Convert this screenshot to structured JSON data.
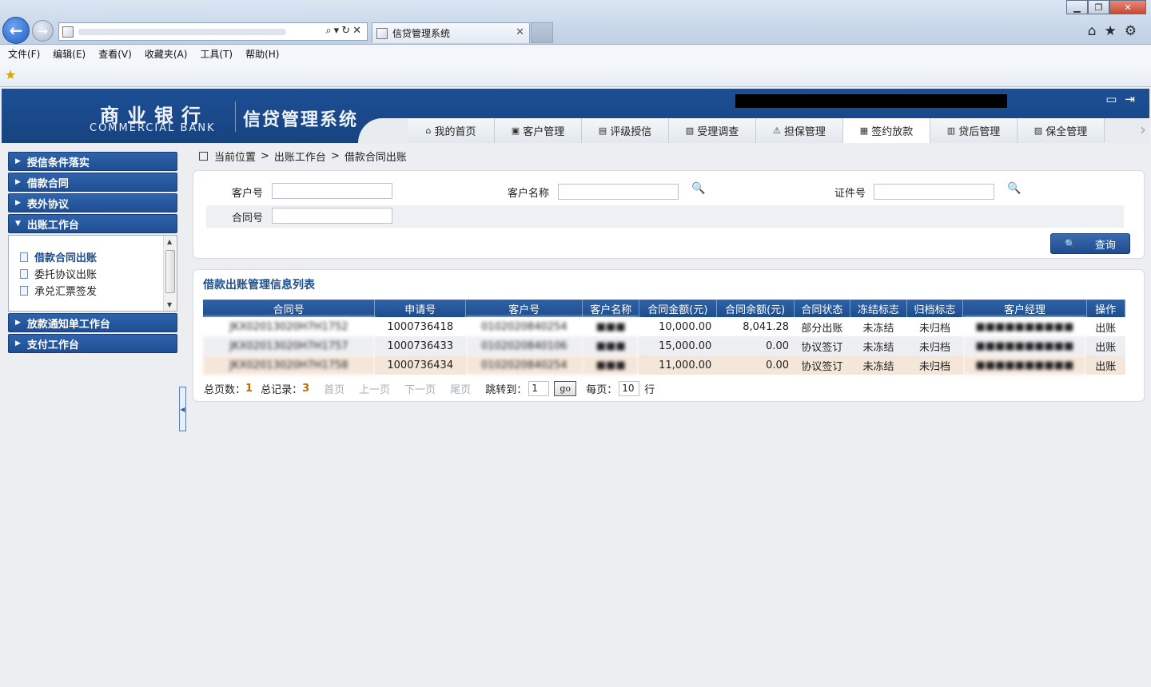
{
  "browser": {
    "tab_title": "信贷管理系统",
    "menus": [
      "文件(F)",
      "编辑(E)",
      "查看(V)",
      "收藏夹(A)",
      "工具(T)",
      "帮助(H)"
    ]
  },
  "header": {
    "brand_cn": "商业银行",
    "brand_en": "COMMERCIAL BANK",
    "system_name": "信贷管理系统"
  },
  "topnav": [
    {
      "label": "我的首页",
      "icon": "⌂"
    },
    {
      "label": "客户管理",
      "icon": "▣"
    },
    {
      "label": "评级授信",
      "icon": "▤"
    },
    {
      "label": "受理调查",
      "icon": "▧"
    },
    {
      "label": "担保管理",
      "icon": "⚠"
    },
    {
      "label": "签约放款",
      "icon": "▦"
    },
    {
      "label": "贷后管理",
      "icon": "▥"
    },
    {
      "label": "保全管理",
      "icon": "▨"
    }
  ],
  "sidebar": {
    "groups": [
      "授信条件落实",
      "借款合同",
      "表外协议",
      "出账工作台"
    ],
    "sub_items": [
      "借款合同出账",
      "委托协议出账",
      "承兑汇票签发"
    ],
    "groups_after": [
      "放款通知单工作台",
      "支付工作台"
    ]
  },
  "breadcrumb": {
    "prefix": "当前位置",
    "items": [
      "出账工作台",
      "借款合同出账"
    ]
  },
  "search": {
    "customer_no_label": "客户号",
    "customer_name_label": "客户名称",
    "id_no_label": "证件号",
    "contract_no_label": "合同号",
    "query_button": "查询"
  },
  "list": {
    "title": "借款出账管理信息列表",
    "columns": [
      "合同号",
      "申请号",
      "客户号",
      "客户名称",
      "合同金额(元)",
      "合同余额(元)",
      "合同状态",
      "冻结标志",
      "归档标志",
      "客户经理",
      "操作"
    ],
    "rows": [
      {
        "contract_no": "JKX02013020H7H1752",
        "app_no": "1000736418",
        "customer_no": "0102020840254",
        "customer_name": "■■■",
        "amount": "10,000.00",
        "balance": "8,041.28",
        "status": "部分出账",
        "frozen": "未冻结",
        "archive": "未归档",
        "manager": "■■■■■■■■■■",
        "action": "出账"
      },
      {
        "contract_no": "JKX02013020H7H1757",
        "app_no": "1000736433",
        "customer_no": "0102020840106",
        "customer_name": "■■■",
        "amount": "15,000.00",
        "balance": "0.00",
        "status": "协议签订",
        "frozen": "未冻结",
        "archive": "未归档",
        "manager": "■■■■■■■■■■",
        "action": "出账"
      },
      {
        "contract_no": "JKX02013020H7H1758",
        "app_no": "1000736434",
        "customer_no": "0102020840254",
        "customer_name": "■■■",
        "amount": "11,000.00",
        "balance": "0.00",
        "status": "协议签订",
        "frozen": "未冻结",
        "archive": "未归档",
        "manager": "■■■■■■■■■■",
        "action": "出账"
      }
    ]
  },
  "pager": {
    "total_pages_label": "总页数：",
    "total_pages": "1",
    "total_records_label": "总记录：",
    "total_records": "3",
    "first": "首页",
    "prev": "上一页",
    "next": "下一页",
    "last": "尾页",
    "jump_label": "跳转到：",
    "jump_value": "1",
    "go": "go",
    "per_page_label": "每页：",
    "per_page": "10",
    "row_unit": "行"
  },
  "colors": {
    "header_blue": "#1d4f96",
    "link_blue": "#1f57b8",
    "count_orange": "#c46a00"
  }
}
